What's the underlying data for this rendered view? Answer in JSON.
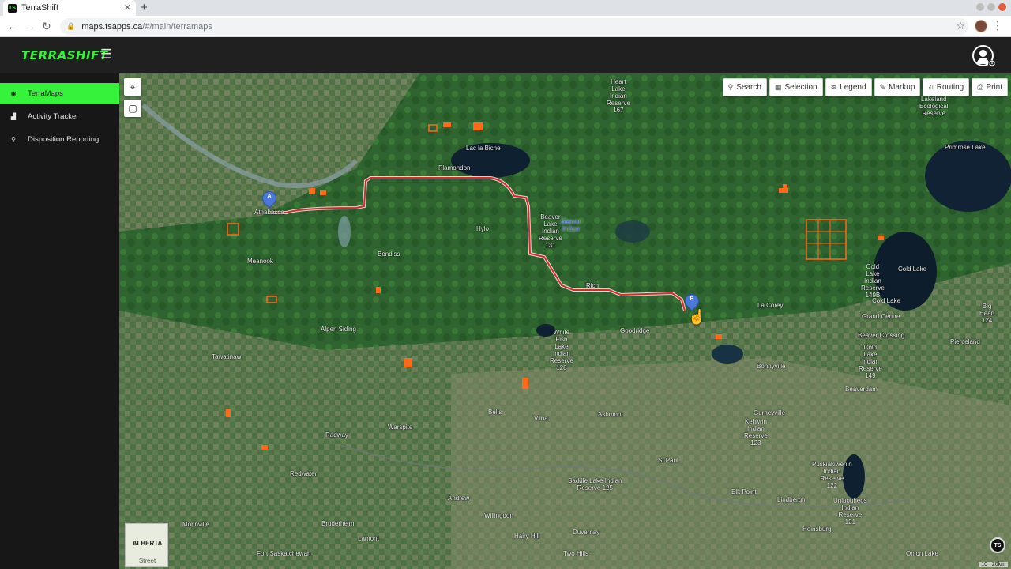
{
  "browser": {
    "tab_title": "TerraShift",
    "tab_favicon": "TS",
    "new_tab": "+",
    "close_tab": "✕",
    "url_host": "maps.tsapps.ca",
    "url_path": "/#/main/terramaps"
  },
  "app": {
    "logo": "TERRASHIFT",
    "accent_color": "#37f23a"
  },
  "sidebar": {
    "items": [
      {
        "label": "TerraMaps",
        "icon": "globe-icon",
        "active": true
      },
      {
        "label": "Activity Tracker",
        "icon": "chart-icon",
        "active": false
      },
      {
        "label": "Disposition Reporting",
        "icon": "search-icon",
        "active": false
      }
    ]
  },
  "toolbar": {
    "search": "Search",
    "selection": "Selection",
    "legend": "Legend",
    "markup": "Markup",
    "routing": "Routing",
    "print": "Print"
  },
  "markers": {
    "a": "A",
    "b": "B"
  },
  "minimap": {
    "title": "ALBERTA",
    "style": "Street"
  },
  "badge": "TS",
  "scale": {
    "small": "10",
    "large": "20km"
  },
  "places": [
    "Heart\nLake\nIndian\nReserve\n167",
    "Lakeland\nEcological\nReserve",
    "Lac la Biche",
    "Primrose Lake",
    "Plamondon",
    "Athabasca",
    "Hylo",
    "Beaver\nLake\nIndian\nReserve\n131",
    "Beaver\nIndian",
    "Bondiss",
    "Meanook",
    "Cold\nLake\nIndian\nReserve\n149B",
    "Cold Lake",
    "Cold Lake",
    "La Corey",
    "Grand Centre",
    "Big\nHead\n124",
    "Alpen Siding",
    "White\nFish\nLake\nIndian\nReserve\n128",
    "Goodridge",
    "Beaver Crossing",
    "Cold\nLake\nIndian\nReserve\n149",
    "Pierceland",
    "Tawatinaw",
    "Bonnyville",
    "Beaverdam",
    "Bells",
    "Vilna",
    "Ashmont",
    "Gurneyville",
    "Kehiwin\nIndian\nReserve\n123",
    "Radway",
    "Warspite",
    "St Paul",
    "Puskiakiwenin\nIndian\nReserve\n122",
    "Redwater",
    "Saddle Lake Indian\nReserve 125",
    "Elk Point",
    "Andrew",
    "Lindbergh",
    "Unipouheos\nIndian\nReserve\n121",
    "Morinville",
    "Bruderheim",
    "Willingdon",
    "Heinsburg",
    "Lamont",
    "Hairy Hill",
    "Duvernay",
    "Fort Saskatchewan",
    "Two Hills",
    "Onion Lake",
    "Rich"
  ]
}
